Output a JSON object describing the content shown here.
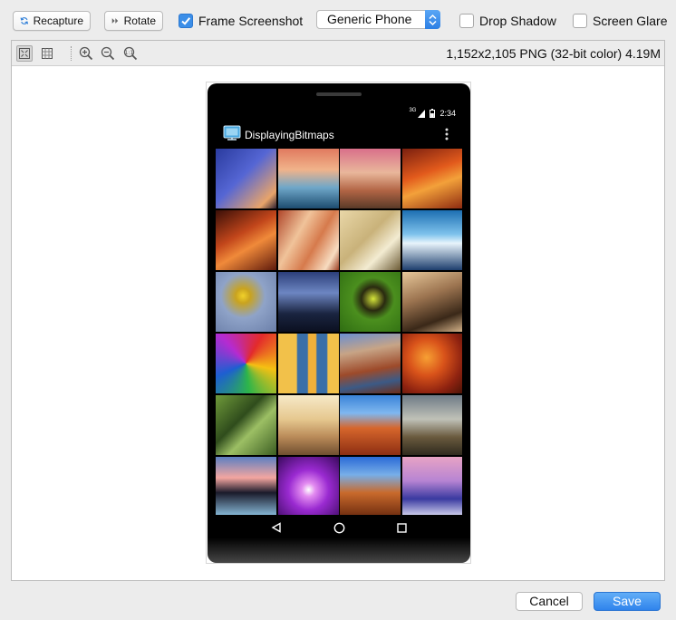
{
  "toolbar": {
    "recapture_label": "Recapture",
    "rotate_label": "Rotate",
    "frame_screenshot": {
      "label": "Frame Screenshot",
      "checked": true
    },
    "device_select": {
      "value": "Generic Phone"
    },
    "drop_shadow": {
      "label": "Drop Shadow",
      "checked": false
    },
    "screen_glare": {
      "label": "Screen Glare",
      "checked": false
    }
  },
  "viewer": {
    "tools": [
      "fit-window-icon",
      "actual-size-icon",
      "zoom-in-icon",
      "zoom-out-icon",
      "zoom-reset-icon"
    ],
    "image_info": "1,152x2,105 PNG (32-bit color) 4.19M"
  },
  "phone": {
    "status_time": "2:34",
    "status_network": "3G",
    "app_title": "DisplayingBitmaps",
    "nav_buttons": [
      "back-icon",
      "home-icon",
      "recents-icon"
    ]
  },
  "footer": {
    "cancel_label": "Cancel",
    "save_label": "Save"
  },
  "colors": {
    "accent": "#3b8ee8",
    "phone_frame": "#000000",
    "toolbar_bg": "#ececec"
  }
}
